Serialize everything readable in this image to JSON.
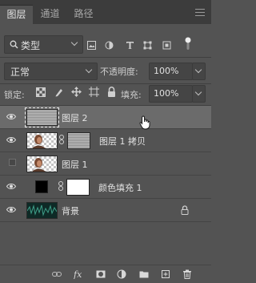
{
  "tabs": [
    "图层",
    "通道",
    "路径"
  ],
  "filter": {
    "kind_label": "类型"
  },
  "blend": {
    "mode": "正常",
    "opacity_label": "不透明度:",
    "opacity_value": "100%"
  },
  "lock": {
    "label": "锁定:",
    "fill_label": "填充:",
    "fill_value": "100%"
  },
  "layers": [
    {
      "name": "图层 2",
      "visible": true,
      "selected": true
    },
    {
      "name": "图层 1 拷贝",
      "visible": true
    },
    {
      "name": "图层 1",
      "visible": false
    },
    {
      "name": "颜色填充 1",
      "visible": true
    },
    {
      "name": "背景",
      "visible": true,
      "locked": true
    }
  ],
  "colors": {
    "panel": "#535353",
    "selected_row": "#6b6b6b",
    "field": "#454545"
  }
}
